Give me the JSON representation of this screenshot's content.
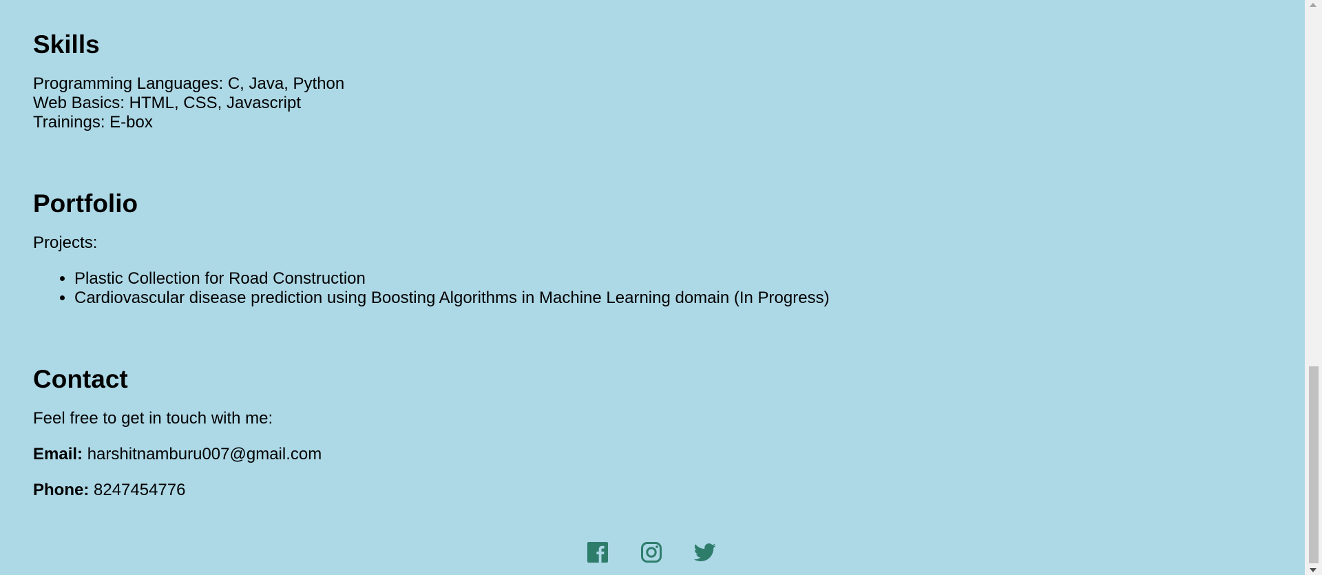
{
  "skills": {
    "heading": "Skills",
    "lines": [
      "Programming Languages: C, Java, Python",
      "Web Basics: HTML, CSS, Javascript",
      "Trainings: E-box"
    ]
  },
  "portfolio": {
    "heading": "Portfolio",
    "intro": "Projects:",
    "projects": [
      "Plastic Collection for Road Construction",
      "Cardiovascular disease prediction using Boosting Algorithms in Machine Learning domain (In Progress)"
    ]
  },
  "contact": {
    "heading": "Contact",
    "intro": "Feel free to get in touch with me:",
    "email_label": "Email:",
    "email_value": "harshitnamburu007@gmail.com",
    "phone_label": "Phone:",
    "phone_value": "8247454776"
  },
  "social": {
    "icons": [
      "facebook-icon",
      "instagram-icon",
      "twitter-icon"
    ],
    "color": "#2e7d6b"
  },
  "colors": {
    "background": "#add8e6",
    "text": "#000000"
  }
}
